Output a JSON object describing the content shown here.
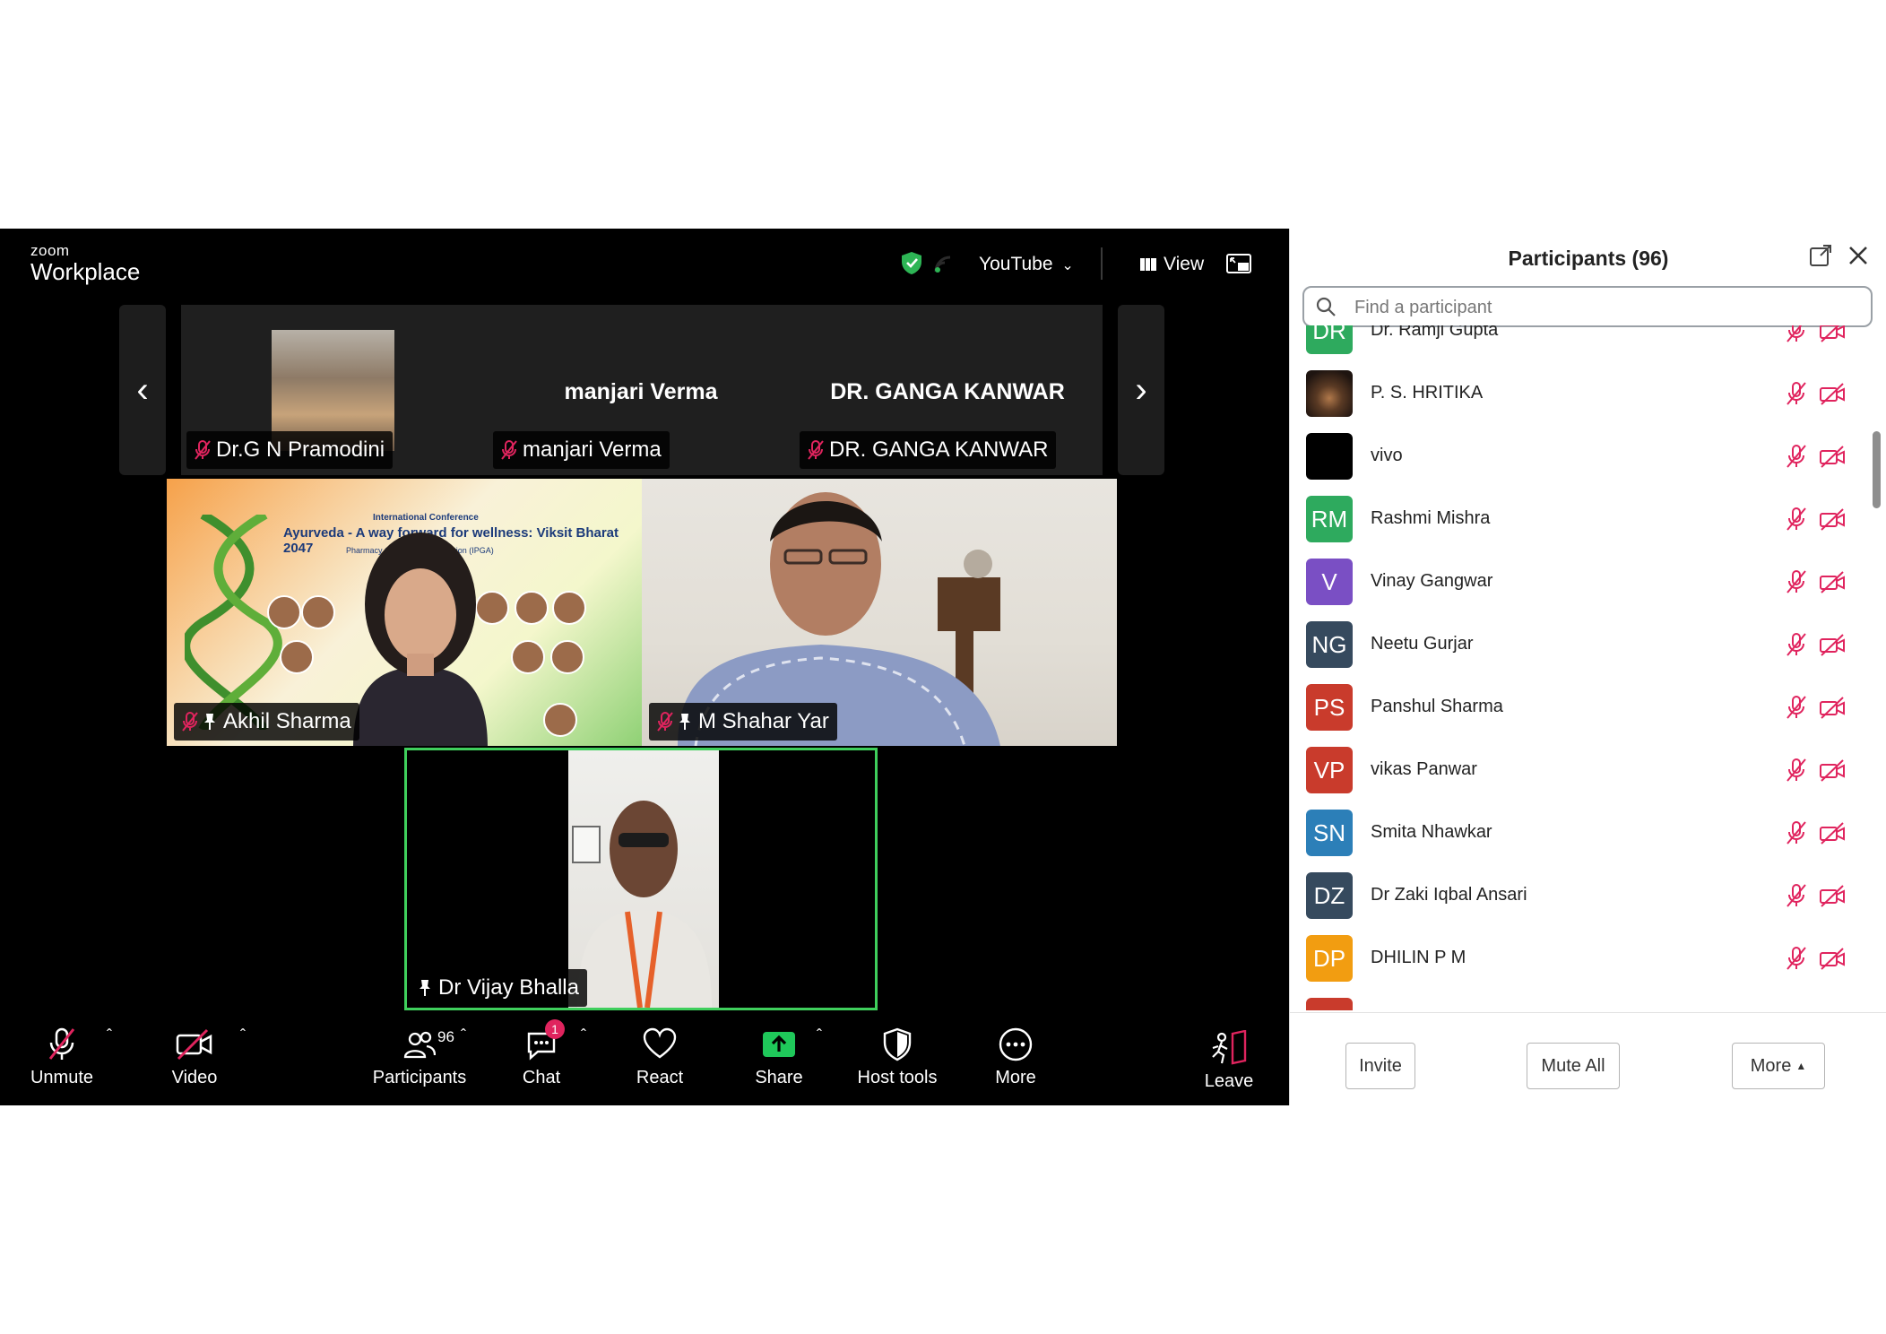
{
  "app": {
    "logo_line1": "zoom",
    "logo_line2": "Workplace"
  },
  "topbar": {
    "youtube_label": "YouTube",
    "view_label": "View",
    "encryption": "green-shield-icon"
  },
  "gallery": {
    "thumbs": [
      {
        "name": "Dr.G N Pramodini",
        "muted": true
      },
      {
        "big_name": "manjari Verma",
        "name": "manjari Verma",
        "muted": true
      },
      {
        "big_name": "DR. GANGA KANWAR",
        "name": "DR. GANGA KANWAR",
        "muted": true
      }
    ],
    "tiles": [
      {
        "name": "Akhil Sharma",
        "muted": true,
        "pinned": true,
        "poster_line1": "International Conference",
        "poster_line2": "Ayurveda - A way forward for wellness: Viksit Bharat 2047",
        "poster_line3": "Pharmacy Graduate's Association (IPGA)"
      },
      {
        "name": "M Shahar Yar",
        "muted": true,
        "pinned": true
      },
      {
        "name": "Dr Vijay Bhalla",
        "muted": false,
        "pinned": true,
        "active_speaker": true
      }
    ]
  },
  "toolbar": {
    "unmute": "Unmute",
    "video": "Video",
    "participants": "Participants",
    "participants_count": "96",
    "chat": "Chat",
    "chat_badge": "1",
    "react": "React",
    "share": "Share",
    "host_tools": "Host tools",
    "more": "More",
    "leave": "Leave"
  },
  "panel": {
    "title": "Participants (96)",
    "search_placeholder": "Find a participant",
    "participants": [
      {
        "initials": "DR",
        "name": "Dr. Ramji Gupta",
        "color": "#2eaa5e"
      },
      {
        "initials": "",
        "name": "P. S. HRITIKA",
        "color": "#3a2a1e",
        "photo": true
      },
      {
        "initials": "",
        "name": "vivo",
        "color": "#000000"
      },
      {
        "initials": "RM",
        "name": "Rashmi Mishra",
        "color": "#2eaa5e"
      },
      {
        "initials": "V",
        "name": "Vinay Gangwar",
        "color": "#7a4fc4"
      },
      {
        "initials": "NG",
        "name": "Neetu Gurjar",
        "color": "#364a5e"
      },
      {
        "initials": "PS",
        "name": "Panshul Sharma",
        "color": "#c93b2c"
      },
      {
        "initials": "VP",
        "name": "vikas Panwar",
        "color": "#c93b2c"
      },
      {
        "initials": "SN",
        "name": "Smita Nhawkar",
        "color": "#2c7fb8"
      },
      {
        "initials": "DZ",
        "name": "Dr Zaki Iqbal Ansari",
        "color": "#364a5e"
      },
      {
        "initials": "DP",
        "name": "DHILIN P M",
        "color": "#f29d11"
      }
    ],
    "buttons": {
      "invite": "Invite",
      "mute_all": "Mute All",
      "more": "More"
    },
    "muted_color": "#e0245e"
  }
}
